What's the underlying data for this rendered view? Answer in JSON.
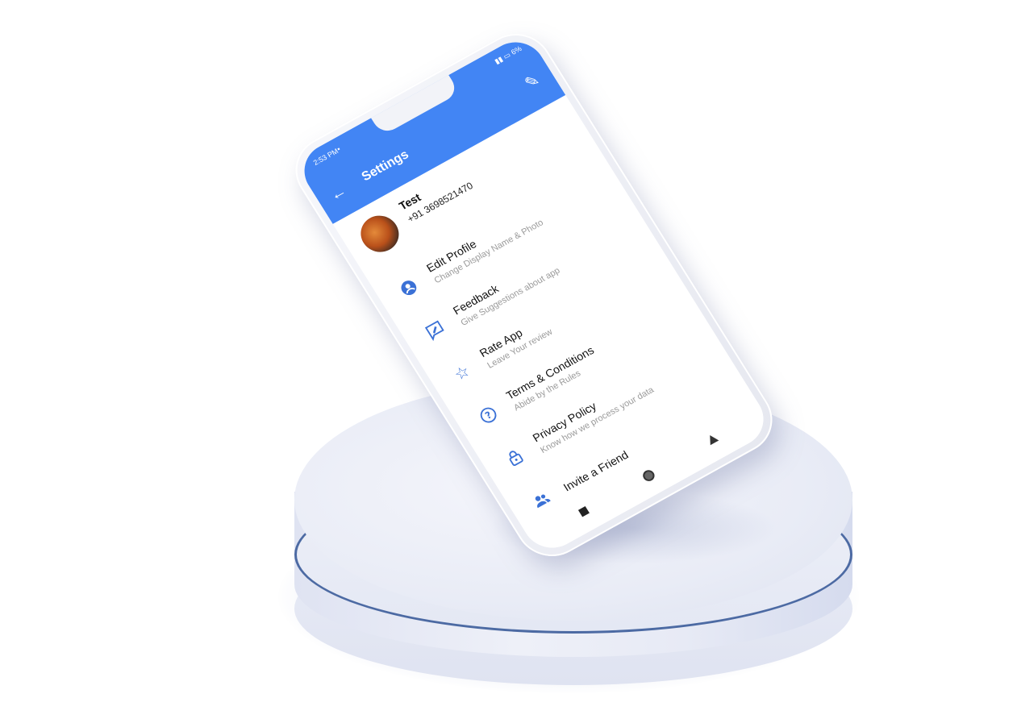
{
  "status_bar": {
    "time": "2:53 PM",
    "left_icon": "sim-icon",
    "right": "6%"
  },
  "appbar": {
    "title": "Settings",
    "back_icon": "back-arrow-icon",
    "edit_icon": "pencil-icon"
  },
  "profile": {
    "name": "Test",
    "phone": "+91 3698521470"
  },
  "menu": [
    {
      "label": "Edit Profile",
      "sub": "Change Display Name & Photo",
      "icon": "account-circle-icon"
    },
    {
      "label": "Feedback",
      "sub": "Give Suggestions about app",
      "icon": "feedback-icon"
    },
    {
      "label": "Rate App",
      "sub": "Leave Your review",
      "icon": "star-outline-icon"
    },
    {
      "label": "Terms & Conditions",
      "sub": "Abide by the Rules",
      "icon": "help-circle-icon"
    },
    {
      "label": "Privacy Policy",
      "sub": "Know how we process your data",
      "icon": "lock-icon"
    },
    {
      "label": "Invite a Friend",
      "sub": "",
      "icon": "people-icon"
    }
  ],
  "colors": {
    "accent": "#4285f4",
    "icon": "#3b71d6"
  }
}
